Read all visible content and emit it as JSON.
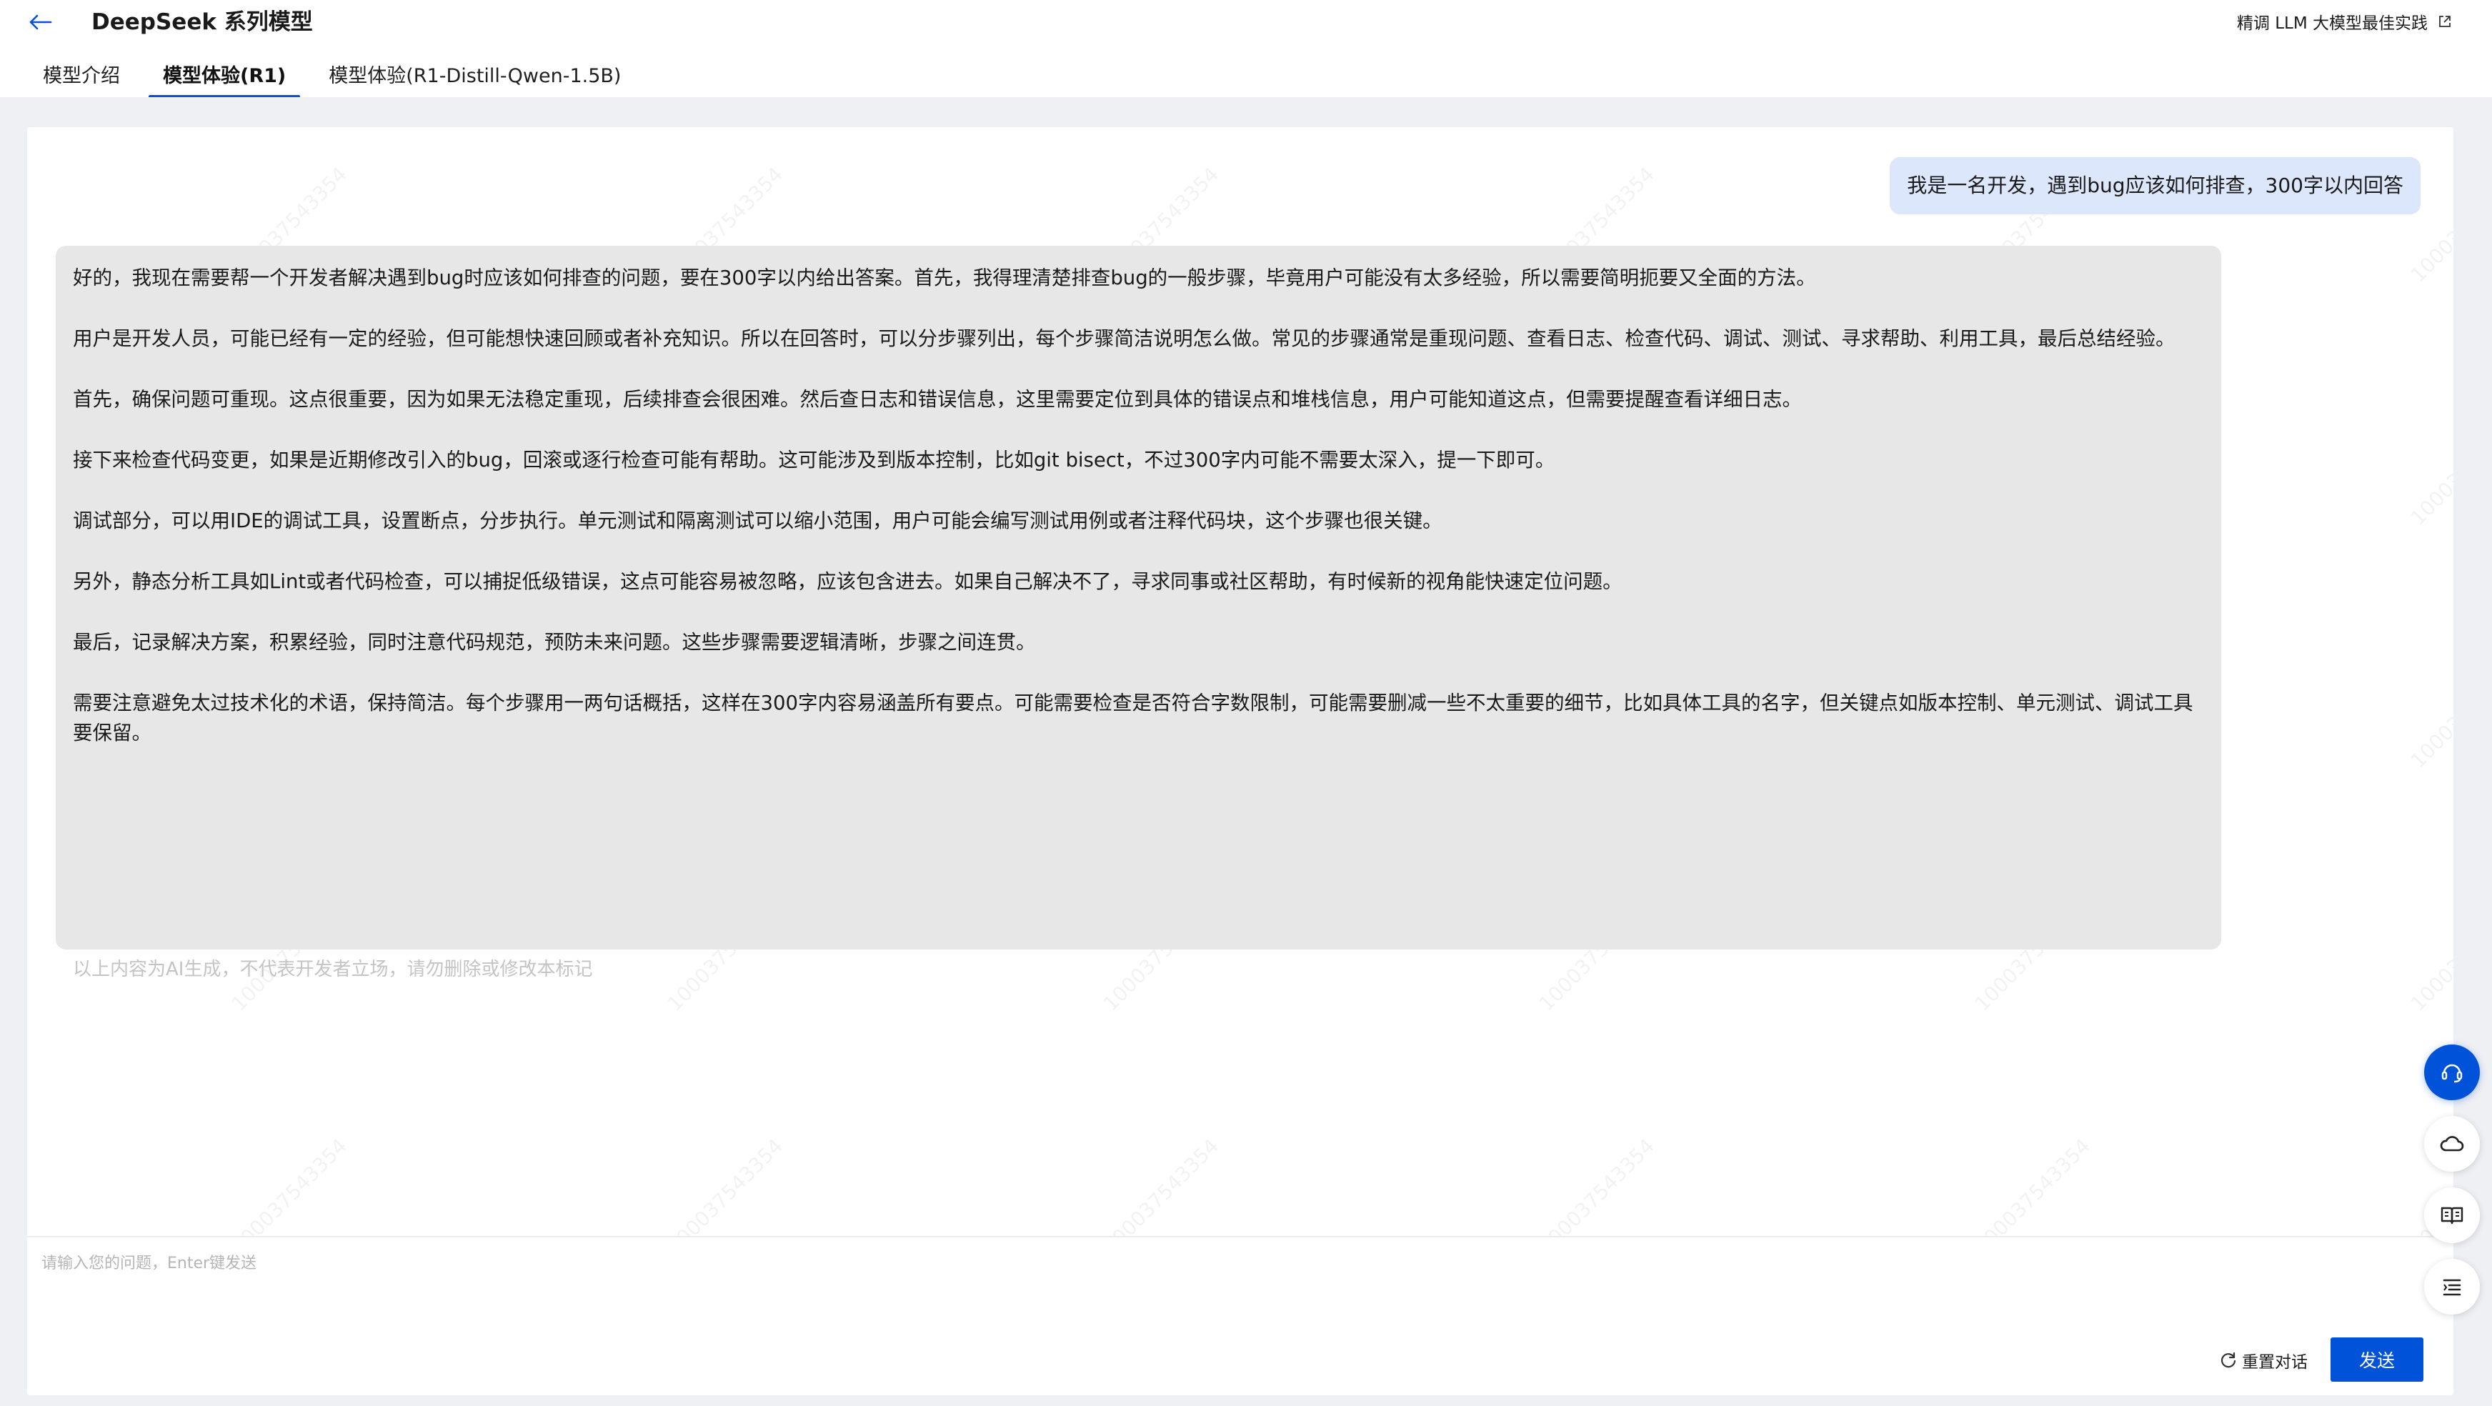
{
  "header": {
    "title": "DeepSeek 系列模型",
    "top_link": "精调 LLM 大模型最佳实践"
  },
  "tabs": [
    {
      "label": "模型介绍",
      "active": false
    },
    {
      "label": "模型体验(R1)",
      "active": true
    },
    {
      "label": "模型体验(R1-Distill-Qwen-1.5B)",
      "active": false
    }
  ],
  "chat": {
    "user_message": "我是一名开发，遇到bug应该如何排查，300字以内回答",
    "ai_paragraphs": [
      "好的，我现在需要帮一个开发者解决遇到bug时应该如何排查的问题，要在300字以内给出答案。首先，我得理清楚排查bug的一般步骤，毕竟用户可能没有太多经验，所以需要简明扼要又全面的方法。",
      "用户是开发人员，可能已经有一定的经验，但可能想快速回顾或者补充知识。所以在回答时，可以分步骤列出，每个步骤简洁说明怎么做。常见的步骤通常是重现问题、查看日志、检查代码、调试、测试、寻求帮助、利用工具，最后总结经验。",
      "首先，确保问题可重现。这点很重要，因为如果无法稳定重现，后续排查会很困难。然后查日志和错误信息，这里需要定位到具体的错误点和堆栈信息，用户可能知道这点，但需要提醒查看详细日志。",
      "接下来检查代码变更，如果是近期修改引入的bug，回滚或逐行检查可能有帮助。这可能涉及到版本控制，比如git bisect，不过300字内可能不需要太深入，提一下即可。",
      "调试部分，可以用IDE的调试工具，设置断点，分步执行。单元测试和隔离测试可以缩小范围，用户可能会编写测试用例或者注释代码块，这个步骤也很关键。",
      "另外，静态分析工具如Lint或者代码检查，可以捕捉低级错误，这点可能容易被忽略，应该包含进去。如果自己解决不了，寻求同事或社区帮助，有时候新的视角能快速定位问题。",
      "最后，记录解决方案，积累经验，同时注意代码规范，预防未来问题。这些步骤需要逻辑清晰，步骤之间连贯。",
      "需要注意避免太过技术化的术语，保持简洁。每个步骤用一两句话概括，这样在300字内容易涵盖所有要点。可能需要检查是否符合字数限制，可能需要删减一些不太重要的细节，比如具体工具的名字，但关键点如版本控制、单元测试、调试工具要保留。"
    ],
    "ai_note": "以上内容为AI生成，不代表开发者立场，请勿删除或修改本标记",
    "watermark": "100037543354"
  },
  "input": {
    "placeholder": "请输入您的问题，Enter键发送",
    "value": "",
    "reset_label": "重置对话",
    "send_label": "发送"
  },
  "float_buttons": [
    {
      "name": "customer-service-icon"
    },
    {
      "name": "cloud-icon"
    },
    {
      "name": "book-icon"
    },
    {
      "name": "list-icon"
    }
  ],
  "colors": {
    "primary": "#0052d9",
    "user_bubble": "#dde7fb",
    "ai_bubble": "#e7e7e7",
    "page_bg": "#eef0f3"
  }
}
